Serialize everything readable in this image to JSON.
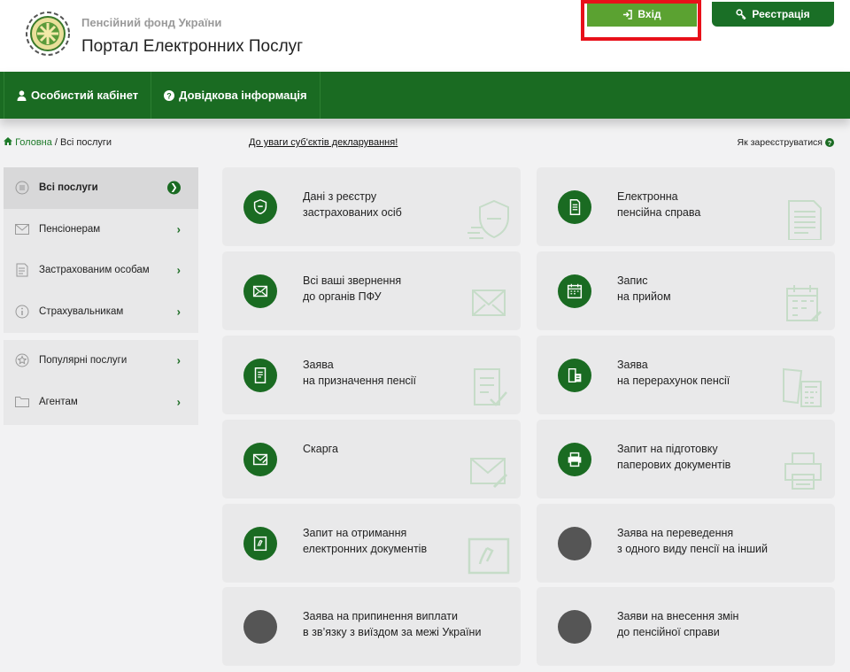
{
  "header": {
    "org_name": "Пенсійний фонд України",
    "portal_name": "Портал Електронних Послуг",
    "login_label": "Вхід",
    "register_label": "Реєстрація"
  },
  "nav": {
    "cabinet": "Особистий кабінет",
    "help": "Довідкова інформація"
  },
  "breadcrumb": {
    "home": "Головна",
    "separator": "/",
    "current": "Всі послуги"
  },
  "notice_link": "До уваги суб'єктів декларування!",
  "howto_link": "Як зареєструватися",
  "sidebar": {
    "group1": [
      {
        "label": "Всі послуги",
        "icon": "list-icon",
        "active": true
      },
      {
        "label": "Пенсіонерам",
        "icon": "envelope-icon"
      },
      {
        "label": "Застрахованим особам",
        "icon": "document-icon"
      },
      {
        "label": "Страхувальникам",
        "icon": "info-icon"
      }
    ],
    "group2": [
      {
        "label": "Популярні послуги",
        "icon": "star-icon"
      },
      {
        "label": "Агентам",
        "icon": "folder-icon"
      }
    ]
  },
  "cards": [
    {
      "line1": "Дані з реєстру",
      "line2": "застрахованих осіб",
      "icon": "shield-icon"
    },
    {
      "line1": "Електронна",
      "line2": "пенсійна справа",
      "icon": "document-icon"
    },
    {
      "line1": "Всі ваші звернення",
      "line2": "до органів ПФУ",
      "icon": "envelope-icon"
    },
    {
      "line1": "Запис",
      "line2": "на прийом",
      "icon": "calendar-icon"
    },
    {
      "line1": "Заява",
      "line2": "на призначення пенсії",
      "icon": "form-icon"
    },
    {
      "line1": "Заява",
      "line2": "на перерахунок пенсії",
      "icon": "calculator-icon"
    },
    {
      "line1": "Скарга",
      "line2": "",
      "icon": "complaint-envelope-icon"
    },
    {
      "line1": "Запит на підготовку",
      "line2": "паперових документів",
      "icon": "printer-icon"
    },
    {
      "line1": "Запит на отримання",
      "line2": "електронних документів",
      "icon": "e-document-icon"
    },
    {
      "line1": "Заява на переведення",
      "line2": "з одного виду пенсії на інший",
      "icon": "blank-icon"
    },
    {
      "line1": "Заява на припинення виплати",
      "line2": "в зв’язку з виїздом за межі України",
      "icon": "blank-icon"
    },
    {
      "line1": "Заяви на внесення змін",
      "line2": "до пенсійної справи",
      "icon": "blank-icon"
    }
  ],
  "colors": {
    "brand_green": "#1a6b22",
    "login_green": "#5ba231",
    "highlight_red": "#e8101a"
  }
}
